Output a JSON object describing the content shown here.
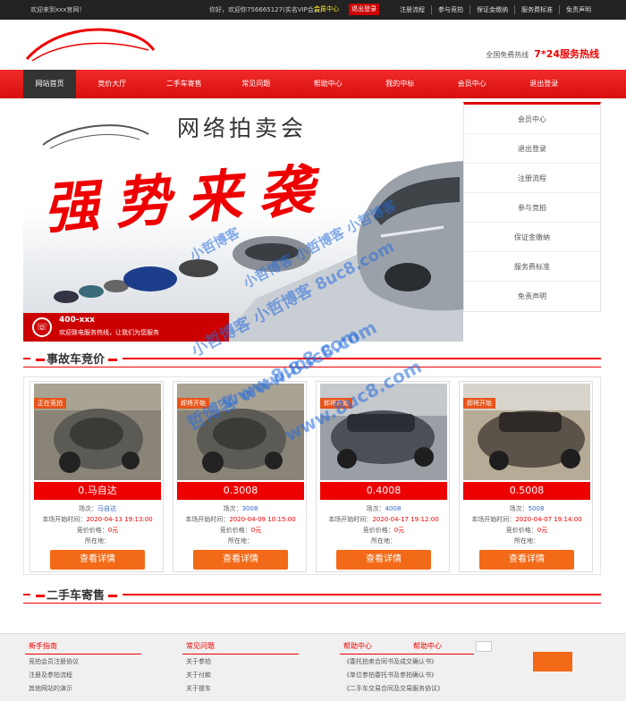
{
  "topbar": {
    "welcome": "欢迎来到xxx官网！",
    "user_info": "你好，欢迎你7566651​27(实名VIP会员)!",
    "member_link": "会员中心",
    "logout_link": "退出登录",
    "nav": [
      "注册流程",
      "参与竞拍",
      "保证金缴纳",
      "服务费标准",
      "免责声明"
    ]
  },
  "header": {
    "hotline_label": "全国免费热线",
    "hotline_text": "7*24服务热线"
  },
  "mainnav": [
    "网站首页",
    "竞价大厅",
    "二手车寄售",
    "常见问题",
    "帮助中心",
    "我的中标",
    "会员中心",
    "退出登录"
  ],
  "banner": {
    "title": "网络拍卖会",
    "slogan": "强势来袭",
    "phone": "400-xxx",
    "phone_sub": "欢迎致电服务热线，让我们为您服务"
  },
  "sidemenu": [
    "会员中心",
    "退出登录",
    "注册流程",
    "参与竞拍",
    "保证金缴纳",
    "服务费标准",
    "免责声明"
  ],
  "sections": {
    "accident": "事故车竞价",
    "used": "二手车寄售"
  },
  "cards": [
    {
      "status": "正在竞拍",
      "title": "0.马自达",
      "round_label": "场次：",
      "round": "马自达",
      "start_label": "本场开始时间：",
      "start": "2020-04-13 19:13:00",
      "bid_label": "竞价价格：",
      "bid": "0元",
      "location_label": "所在地：",
      "location": "",
      "button": "查看详情"
    },
    {
      "status": "即将开始",
      "title": "0.3008",
      "round_label": "场次：",
      "round": "3008",
      "start_label": "本场开始时间：",
      "start": "2020-04-09 10:15:00",
      "bid_label": "竞价价格：",
      "bid": "0元",
      "location_label": "所在地：",
      "location": "",
      "button": "查看详情"
    },
    {
      "status": "即将开始",
      "title": "0.4008",
      "round_label": "场次：",
      "round": "4008",
      "start_label": "本场开始时间：",
      "start": "2020-04-17 19:12:00",
      "bid_label": "竞价价格：",
      "bid": "0元",
      "location_label": "所在地：",
      "location": "",
      "button": "查看详情"
    },
    {
      "status": "即将开始",
      "title": "0.5008",
      "round_label": "场次：",
      "round": "5008",
      "start_label": "本场开始时间：",
      "start": "2020-04-07 19:14:00",
      "bid_label": "竞价价格：",
      "bid": "0元",
      "location_label": "所在地：",
      "location": "",
      "button": "查看详情"
    }
  ],
  "footer": {
    "col1": {
      "head": "新手指南",
      "items": [
        "竞拍会员注册协议",
        "注册及参拍流程",
        "其他网站的演示"
      ]
    },
    "col2": {
      "head": "常见问题",
      "items": [
        "关于参拍",
        "关于付款",
        "关于提车"
      ]
    },
    "col3": {
      "head": "帮助中心",
      "items": [
        "《委托拍卖合同书及成交确认书》",
        "《单位参拍委托书及参拍确认书》",
        "《二手车交易合同及交易服务协议》"
      ]
    },
    "col4": {
      "head": "帮助中心"
    }
  },
  "watermarks": [
    "小哲博客",
    "小哲博客 小哲博客 小哲博客",
    "小哲博客 小哲博客 8uc8.com",
    "www.8uc8.com",
    "哲博客 www.8uc8.com",
    "www.8uc8.com"
  ],
  "colors": {
    "brand_red": "#e00000",
    "button_orange": "#f26a17",
    "topbar": "#222222",
    "watermark": "#286edc"
  }
}
